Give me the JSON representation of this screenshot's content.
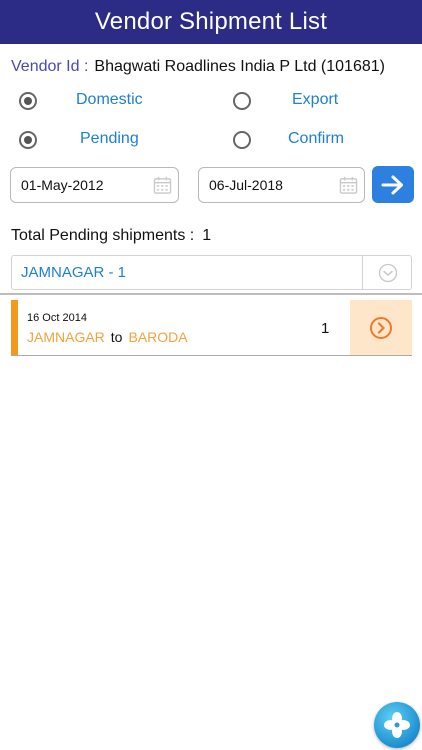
{
  "header": {
    "title": "Vendor Shipment List"
  },
  "vendor": {
    "label": "Vendor Id :",
    "value": "Bhagwati Roadlines India P Ltd (101681)"
  },
  "shipment_type": {
    "options": [
      {
        "label": "Domestic",
        "checked": true
      },
      {
        "label": "Export",
        "checked": false
      }
    ]
  },
  "status_filter": {
    "options": [
      {
        "label": "Pending",
        "checked": true
      },
      {
        "label": "Confirm",
        "checked": false
      }
    ]
  },
  "date_range": {
    "from": "01-May-2012",
    "to": "06-Jul-2018"
  },
  "summary": {
    "label": "Total Pending shipments :",
    "count": "1"
  },
  "location_dropdown": {
    "selected": "JAMNAGAR - 1"
  },
  "shipments": [
    {
      "date": "16 Oct 2014",
      "from": "JAMNAGAR",
      "to_word": "to",
      "to": "BARODA",
      "count": "1"
    }
  ],
  "colors": {
    "header": "#2c2b86",
    "accent_blue": "#1d7fd6",
    "go_button": "#2d7fe0",
    "card_accent": "#f39a1a",
    "card_action_bg": "#fde6c9"
  },
  "icons": {
    "calendar": "calendar-icon",
    "go": "arrow-right-icon",
    "dropdown": "chevron-down-circle-icon",
    "card_action": "chevron-right-circle-icon",
    "fab": "clover-menu-icon"
  }
}
